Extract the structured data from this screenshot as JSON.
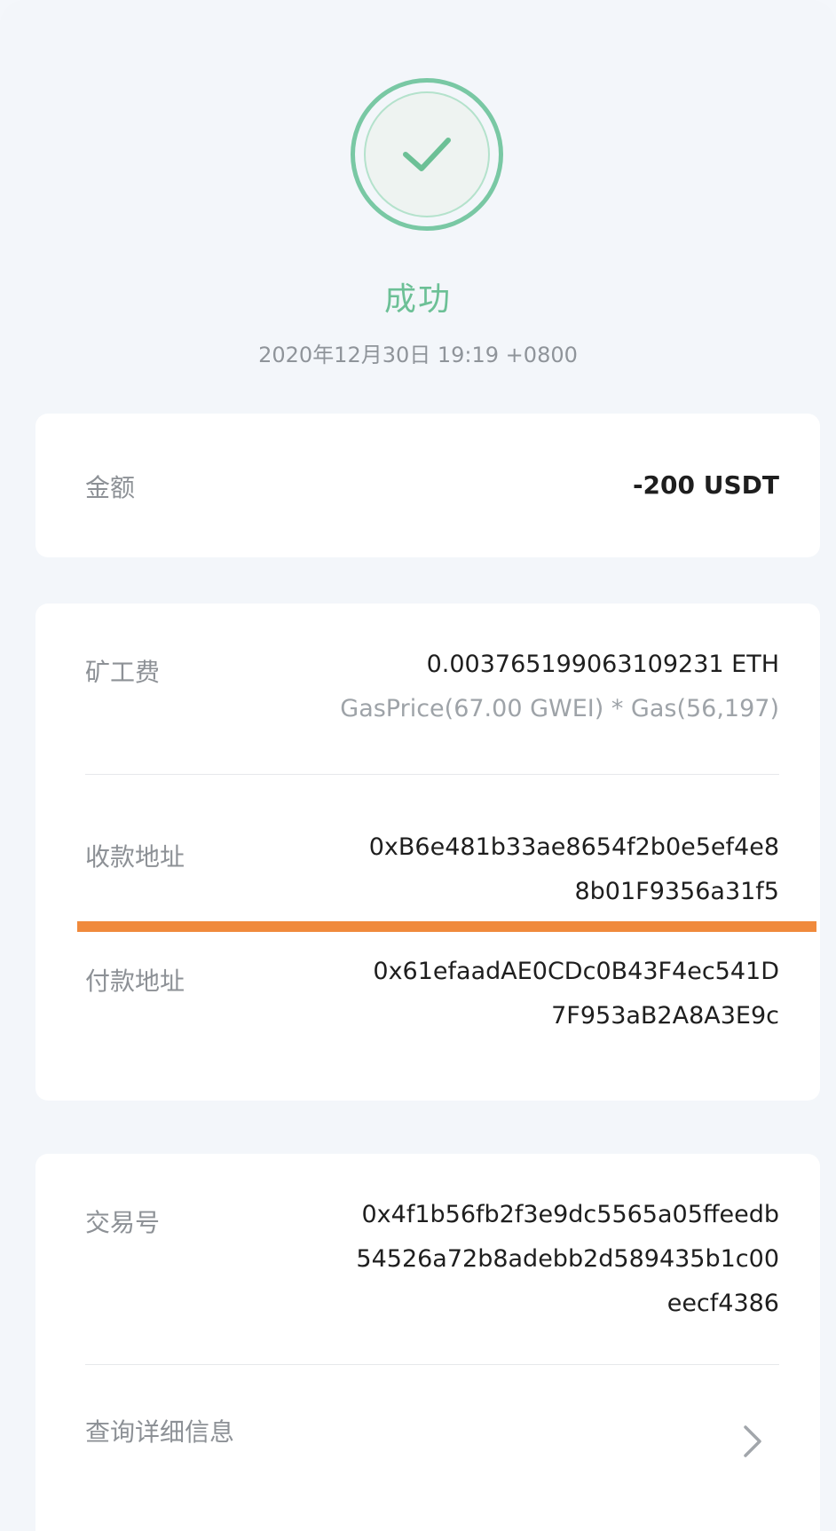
{
  "status": {
    "icon": "check-circle-icon",
    "title": "成功",
    "timestamp": "2020年12月30日 19:19 +0800"
  },
  "amount": {
    "label": "金额",
    "value": "-200 USDT"
  },
  "fee": {
    "label": "矿工费",
    "value": "0.003765199063109231 ETH",
    "detail": "GasPrice(67.00 GWEI) * Gas(56,197)"
  },
  "receiver": {
    "label": "收款地址",
    "value_line1": "0xB6e481b33ae8654f2b0e5ef4e8",
    "value_line2": "8b01F9356a31f5"
  },
  "sender": {
    "label": "付款地址",
    "value_line1": "0x61efaadAE0CDc0B43F4ec541D",
    "value_line2": "7F953aB2A8A3E9c"
  },
  "tx": {
    "label": "交易号",
    "value_line1": "0x4f1b56fb2f3e9dc5565a05ffeedb",
    "value_line2": "54526a72b8adebb2d589435b1c00",
    "value_line3": "eecf4386"
  },
  "details_link": {
    "label": "查询详细信息",
    "icon": "chevron-right-icon"
  },
  "colors": {
    "success": "#6cc096",
    "highlight": "#f08a3c"
  }
}
